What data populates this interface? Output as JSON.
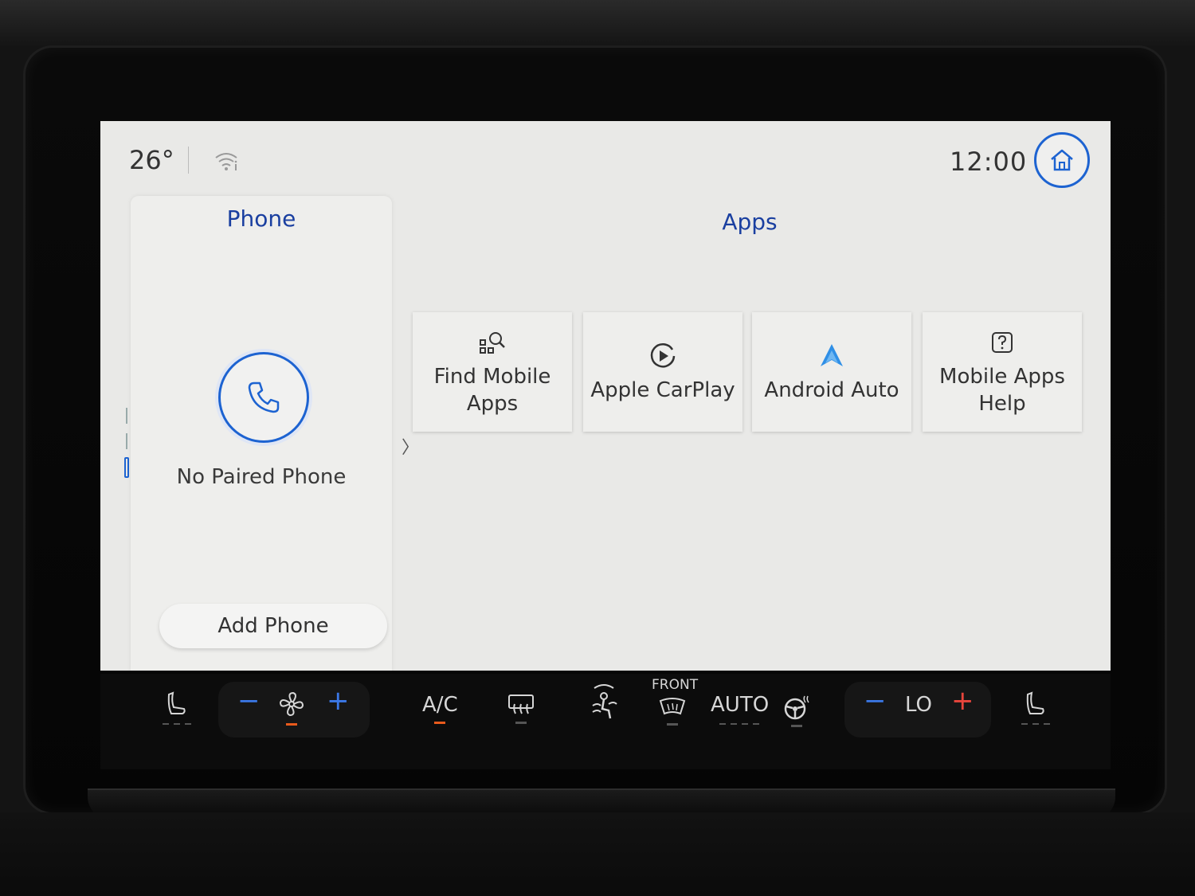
{
  "status": {
    "temperature": "26°",
    "wifi_icon": "wifi-info-icon",
    "clock": "12:00"
  },
  "home_icon": "home-icon",
  "phone_panel": {
    "title": "Phone",
    "status": "No Paired Phone",
    "add_button": "Add Phone"
  },
  "apps_panel": {
    "title": "Apps",
    "tiles": [
      {
        "label": "Find Mobile\nApps",
        "icon": "find-apps-icon"
      },
      {
        "label": "Apple CarPlay",
        "icon": "carplay-icon"
      },
      {
        "label": "Android Auto",
        "icon": "android-auto-icon"
      },
      {
        "label": "Mobile Apps\nHelp",
        "icon": "help-icon"
      }
    ]
  },
  "climate": {
    "ac": "A/C",
    "front": "FRONT",
    "auto": "AUTO",
    "temp_right": "LO",
    "minus": "−",
    "plus": "+"
  },
  "colors": {
    "accent_blue": "#1d63d1",
    "title_blue": "#1a3fa0",
    "screen_bg": "#e9e9e7",
    "android_auto": "#2f8fe6",
    "climate_red": "#e8453c",
    "indicator_orange": "#e85a1c"
  }
}
